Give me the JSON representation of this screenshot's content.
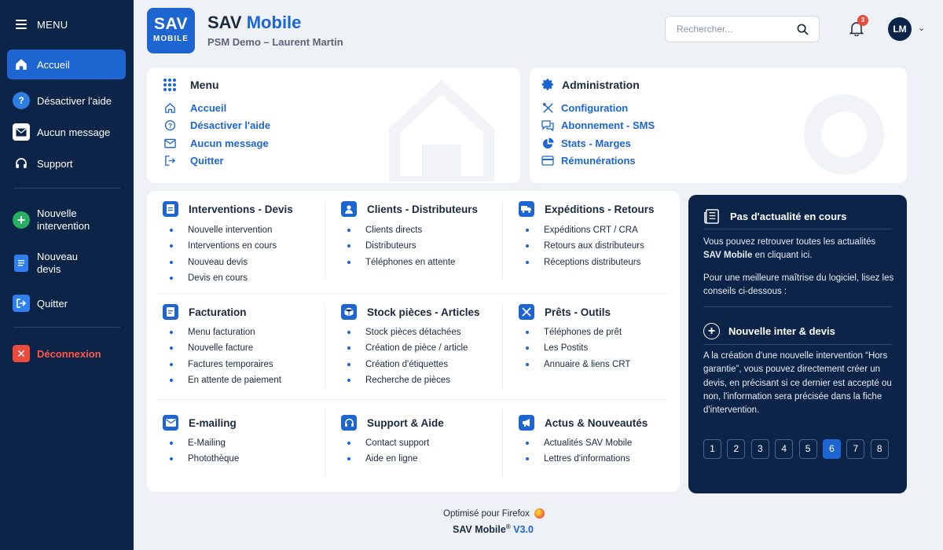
{
  "sidebar": {
    "menu_label": "MENU",
    "items": [
      {
        "label": "Accueil"
      },
      {
        "label": "Désactiver l'aide"
      },
      {
        "label": "Aucun message"
      },
      {
        "label": "Support"
      },
      {
        "label": "Nouvelle intervention"
      },
      {
        "label": "Nouveau devis"
      },
      {
        "label": "Quitter"
      },
      {
        "label": "Déconnexion"
      }
    ]
  },
  "header": {
    "logo_line1": "SAV",
    "logo_line2": "MOBILE",
    "title_part1": "SAV",
    "title_part2": "Mobile",
    "subtitle": "PSM Demo – Laurent Martin",
    "search_placeholder": "Rechercher...",
    "notification_count": "3",
    "avatar_initials": "LM"
  },
  "menu_card": {
    "title": "Menu",
    "links": [
      "Accueil",
      "Désactiver l'aide",
      "Aucun message",
      "Quitter"
    ]
  },
  "admin_card": {
    "title": "Administration",
    "links": [
      "Configuration",
      "Abonnement - SMS",
      "Stats - Marges",
      "Rémunérations"
    ]
  },
  "modules": [
    {
      "title": "Interventions - Devis",
      "items": [
        "Nouvelle intervention",
        "Interventions en cours",
        "Nouveau devis",
        "Devis en cours"
      ]
    },
    {
      "title": "Clients - Distributeurs",
      "items": [
        "Clients directs",
        "Distributeurs",
        "Téléphones en attente"
      ]
    },
    {
      "title": "Expéditions - Retours",
      "items": [
        "Expéditions CRT / CRA",
        "Retours aux distributeurs",
        "Réceptions distributeurs"
      ]
    },
    {
      "title": "Facturation",
      "items": [
        "Menu facturation",
        "Nouvelle facture",
        "Factures temporaires",
        "En attente de paiement"
      ]
    },
    {
      "title": "Stock pièces - Articles",
      "items": [
        "Stock pièces détachées",
        "Création de pièce / article",
        "Création d'étiquettes",
        "Recherche de pièces"
      ]
    },
    {
      "title": "Prêts - Outils",
      "items": [
        "Téléphones de prêt",
        "Les Postits",
        "Annuaire & liens CRT"
      ]
    },
    {
      "title": "E-mailing",
      "items": [
        "E-Mailing",
        "Photothèque"
      ]
    },
    {
      "title": "Support & Aide",
      "items": [
        "Contact support",
        "Aide en ligne"
      ]
    },
    {
      "title": "Actus & Nouveautés",
      "items": [
        "Actualités SAV Mobile",
        "Lettres d'informations"
      ]
    }
  ],
  "news": {
    "title": "Pas d'actualité en cours",
    "p1_text": "Vous pouvez retrouver toutes les actualités",
    "p1_bold": "SAV Mobile",
    "p1_end": "en cliquant ici.",
    "p2": "Pour une meilleure maîtrise du logiciel, lisez les conseils ci-dessous :",
    "inter_title": "Nouvelle inter & devis",
    "inter_text": "A la création d'une nouvelle intervention “Hors garantie”, vous pouvez directement créer un devis, en précisant si ce dernier est accepté ou non, l'information sera précisée dans la fiche d'intervention.",
    "pages": [
      "1",
      "2",
      "3",
      "4",
      "5",
      "6",
      "7",
      "8"
    ],
    "current_page": "6"
  },
  "footer": {
    "optimized": "Optimisé pour Firefox",
    "app": "SAV Mobile",
    "registered": "®",
    "version": "V3.0"
  },
  "colors": {
    "primary": "#1d66d2",
    "navy": "#0b2447",
    "danger": "#e74c3c",
    "success": "#27ae60"
  }
}
